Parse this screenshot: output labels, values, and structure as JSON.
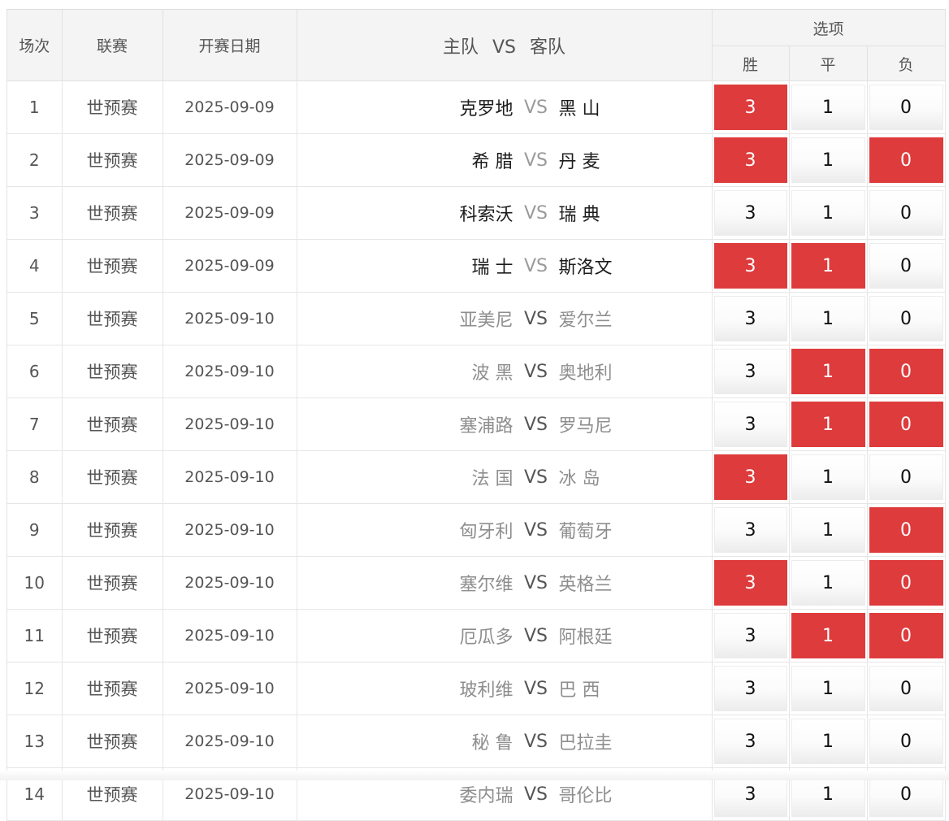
{
  "headers": {
    "index": "场次",
    "league": "联赛",
    "date": "开赛日期",
    "match_home": "主队",
    "match_vs": "VS",
    "match_away": "客队",
    "options": "选项",
    "win": "胜",
    "draw": "平",
    "lose": "负"
  },
  "colors": {
    "selected": "#de3b3c",
    "header_bg": "#f4f4f4"
  },
  "rows": [
    {
      "index": "1",
      "league": "世预赛",
      "date": "2025-09-09",
      "home": "克罗地",
      "vs": "VS",
      "away": "黑 山",
      "style": "dark",
      "win": "3",
      "draw": "1",
      "lose": "0",
      "win_sel": true,
      "draw_sel": false,
      "lose_sel": false
    },
    {
      "index": "2",
      "league": "世预赛",
      "date": "2025-09-09",
      "home": "希 腊",
      "vs": "VS",
      "away": "丹 麦",
      "style": "dark",
      "win": "3",
      "draw": "1",
      "lose": "0",
      "win_sel": true,
      "draw_sel": false,
      "lose_sel": true
    },
    {
      "index": "3",
      "league": "世预赛",
      "date": "2025-09-09",
      "home": "科索沃",
      "vs": "VS",
      "away": "瑞 典",
      "style": "dark",
      "win": "3",
      "draw": "1",
      "lose": "0",
      "win_sel": false,
      "draw_sel": false,
      "lose_sel": false
    },
    {
      "index": "4",
      "league": "世预赛",
      "date": "2025-09-09",
      "home": "瑞 士",
      "vs": "VS",
      "away": "斯洛文",
      "style": "dark",
      "win": "3",
      "draw": "1",
      "lose": "0",
      "win_sel": true,
      "draw_sel": true,
      "lose_sel": false
    },
    {
      "index": "5",
      "league": "世预赛",
      "date": "2025-09-10",
      "home": "亚美尼",
      "vs": "VS",
      "away": "爱尔兰",
      "style": "grey",
      "win": "3",
      "draw": "1",
      "lose": "0",
      "win_sel": false,
      "draw_sel": false,
      "lose_sel": false
    },
    {
      "index": "6",
      "league": "世预赛",
      "date": "2025-09-10",
      "home": "波 黑",
      "vs": "VS",
      "away": "奥地利",
      "style": "grey",
      "win": "3",
      "draw": "1",
      "lose": "0",
      "win_sel": false,
      "draw_sel": true,
      "lose_sel": true
    },
    {
      "index": "7",
      "league": "世预赛",
      "date": "2025-09-10",
      "home": "塞浦路",
      "vs": "VS",
      "away": "罗马尼",
      "style": "grey",
      "win": "3",
      "draw": "1",
      "lose": "0",
      "win_sel": false,
      "draw_sel": true,
      "lose_sel": true
    },
    {
      "index": "8",
      "league": "世预赛",
      "date": "2025-09-10",
      "home": "法 国",
      "vs": "VS",
      "away": "冰 岛",
      "style": "grey",
      "win": "3",
      "draw": "1",
      "lose": "0",
      "win_sel": true,
      "draw_sel": false,
      "lose_sel": false
    },
    {
      "index": "9",
      "league": "世预赛",
      "date": "2025-09-10",
      "home": "匈牙利",
      "vs": "VS",
      "away": "葡萄牙",
      "style": "grey",
      "win": "3",
      "draw": "1",
      "lose": "0",
      "win_sel": false,
      "draw_sel": false,
      "lose_sel": true
    },
    {
      "index": "10",
      "league": "世预赛",
      "date": "2025-09-10",
      "home": "塞尔维",
      "vs": "VS",
      "away": "英格兰",
      "style": "grey",
      "win": "3",
      "draw": "1",
      "lose": "0",
      "win_sel": true,
      "draw_sel": false,
      "lose_sel": true
    },
    {
      "index": "11",
      "league": "世预赛",
      "date": "2025-09-10",
      "home": "厄瓜多",
      "vs": "VS",
      "away": "阿根廷",
      "style": "grey",
      "win": "3",
      "draw": "1",
      "lose": "0",
      "win_sel": false,
      "draw_sel": true,
      "lose_sel": true
    },
    {
      "index": "12",
      "league": "世预赛",
      "date": "2025-09-10",
      "home": "玻利维",
      "vs": "VS",
      "away": "巴 西",
      "style": "grey",
      "win": "3",
      "draw": "1",
      "lose": "0",
      "win_sel": false,
      "draw_sel": false,
      "lose_sel": false
    },
    {
      "index": "13",
      "league": "世预赛",
      "date": "2025-09-10",
      "home": "秘 鲁",
      "vs": "VS",
      "away": "巴拉圭",
      "style": "grey",
      "win": "3",
      "draw": "1",
      "lose": "0",
      "win_sel": false,
      "draw_sel": false,
      "lose_sel": false
    },
    {
      "index": "14",
      "league": "世预赛",
      "date": "2025-09-10",
      "home": "委内瑞",
      "vs": "VS",
      "away": "哥伦比",
      "style": "grey",
      "win": "3",
      "draw": "1",
      "lose": "0",
      "win_sel": false,
      "draw_sel": false,
      "lose_sel": false
    }
  ]
}
